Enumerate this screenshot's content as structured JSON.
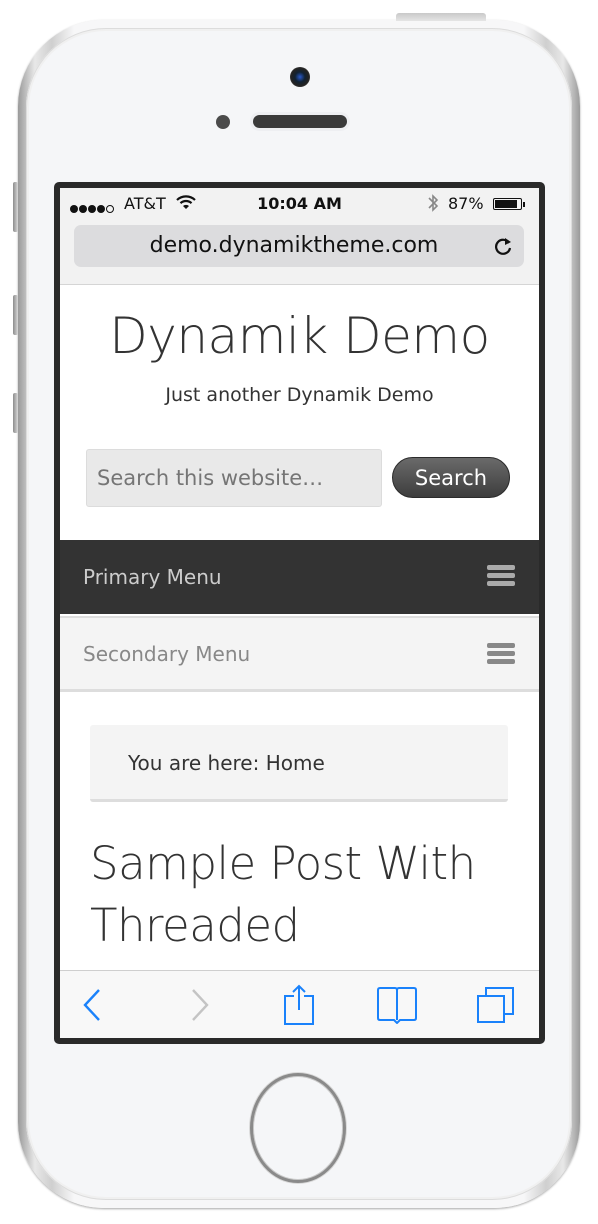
{
  "device": {
    "type": "iPhone",
    "icons": [
      "camera-icon",
      "proximity-sensor-icon",
      "speaker-grille-icon",
      "home-button-icon"
    ]
  },
  "status_bar": {
    "signal_bars": 4,
    "signal_bars_total": 5,
    "carrier": "AT&T",
    "time": "10:04 AM",
    "battery_percent": "87%",
    "battery_level": 0.87
  },
  "browser": {
    "url": "demo.dynamiktheme.com",
    "toolbar": {
      "back": "back-icon",
      "forward": "forward-icon",
      "share": "share-icon",
      "bookmarks": "bookmarks-icon",
      "tabs": "tabs-icon"
    },
    "accent_color": "#1a82fb",
    "disabled_color": "#c4c4c4"
  },
  "site": {
    "title": "Dynamik Demo",
    "description": "Just another Dynamik Demo",
    "search": {
      "placeholder": "Search this website…",
      "value": "",
      "button_label": "Search"
    },
    "primary_menu": {
      "label": "Primary Menu",
      "bg": "#333333"
    },
    "secondary_menu": {
      "label": "Secondary Menu",
      "bg": "#f4f4f4"
    },
    "breadcrumb": "You are here: Home",
    "post_title": "Sample Post With Threaded"
  }
}
